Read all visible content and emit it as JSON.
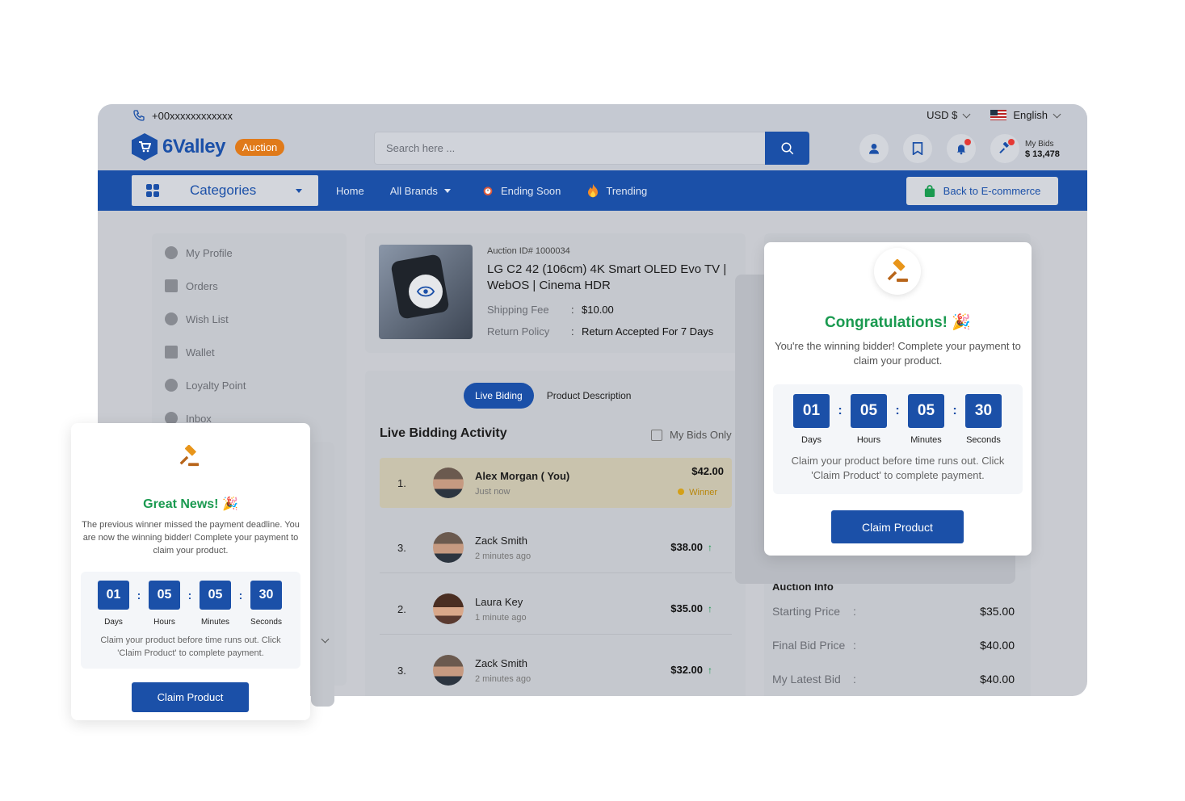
{
  "topbar": {
    "phone": "+00xxxxxxxxxxxx",
    "currency": "USD $",
    "language": "English",
    "my_bids_label": "My Bids",
    "my_bids_value": "$ 13,478"
  },
  "brand": {
    "name": "6Valley",
    "badge": "Auction"
  },
  "search": {
    "placeholder": "Search here ..."
  },
  "nav": {
    "categories_label": "Categories",
    "links": [
      "Home",
      "All Brands",
      "Ending Soon",
      "Trending"
    ],
    "back_button": "Back to E-commerce"
  },
  "sidebar": {
    "items": [
      "My Profile",
      "Orders",
      "Wish List",
      "Wallet",
      "Loyalty Point",
      "Inbox"
    ]
  },
  "product": {
    "auction_id": "Auction ID# 1000034",
    "title": "LG C2 42 (106cm) 4K Smart OLED Evo TV | WebOS | Cinema HDR",
    "shipping_label": "Shipping Fee",
    "shipping_value": "$10.00",
    "return_label": "Return Policy",
    "return_value": "Return Accepted For 7 Days",
    "colon": ":"
  },
  "tabs": {
    "live": "Live Biding",
    "description": "Product Description"
  },
  "bidding": {
    "title": "Live Bidding Activity",
    "filter_label": "My Bids Only",
    "winner_label": "Winner",
    "rows": [
      {
        "rank": "1.",
        "name": "Alex Morgan ( You)",
        "time": "Just now",
        "amount": "$42.00",
        "up_arrow": ""
      },
      {
        "rank": "3.",
        "name": "Zack Smith",
        "time": "2 minutes ago",
        "amount": "$38.00",
        "up_arrow": "↑"
      },
      {
        "rank": "2.",
        "name": "Laura Key",
        "time": "1 minute ago",
        "amount": "$35.00",
        "up_arrow": "↑"
      },
      {
        "rank": "3.",
        "name": "Zack Smith",
        "time": "2 minutes ago",
        "amount": "$32.00",
        "up_arrow": "↑"
      }
    ]
  },
  "auction_info": {
    "title": "Auction Info",
    "colon": ":",
    "starting_label": "Starting Price",
    "starting_value": "$35.00",
    "final_label": "Final Bid Price",
    "final_value": "$40.00",
    "latest_label": "My Latest Bid",
    "latest_value": "$40.00"
  },
  "congrats_popup": {
    "title": "Congratulations!",
    "text": "You're the winning bidder! Complete your payment to claim your product.",
    "days": "01",
    "hours": "05",
    "minutes": "05",
    "seconds": "30",
    "days_label": "Days",
    "hours_label": "Hours",
    "minutes_label": "Minutes",
    "seconds_label": "Seconds",
    "sep": ":",
    "note": "Claim your product before time runs out. Click 'Claim Product' to complete payment.",
    "button": "Claim Product"
  },
  "news_popup": {
    "title": "Great News!",
    "text": "The previous winner missed the payment deadline. You are now the winning bidder! Complete your payment to claim your product.",
    "days": "01",
    "hours": "05",
    "minutes": "05",
    "seconds": "30",
    "days_label": "Days",
    "hours_label": "Hours",
    "minutes_label": "Minutes",
    "seconds_label": "Seconds",
    "sep": ":",
    "note": "Claim your product before time runs out. Click 'Claim Product' to complete payment.",
    "button": "Claim Product"
  },
  "colors": {
    "primary": "#1b50a8",
    "success": "#1a9a50",
    "accent": "#e07a1a",
    "badge_red": "#e53935"
  }
}
